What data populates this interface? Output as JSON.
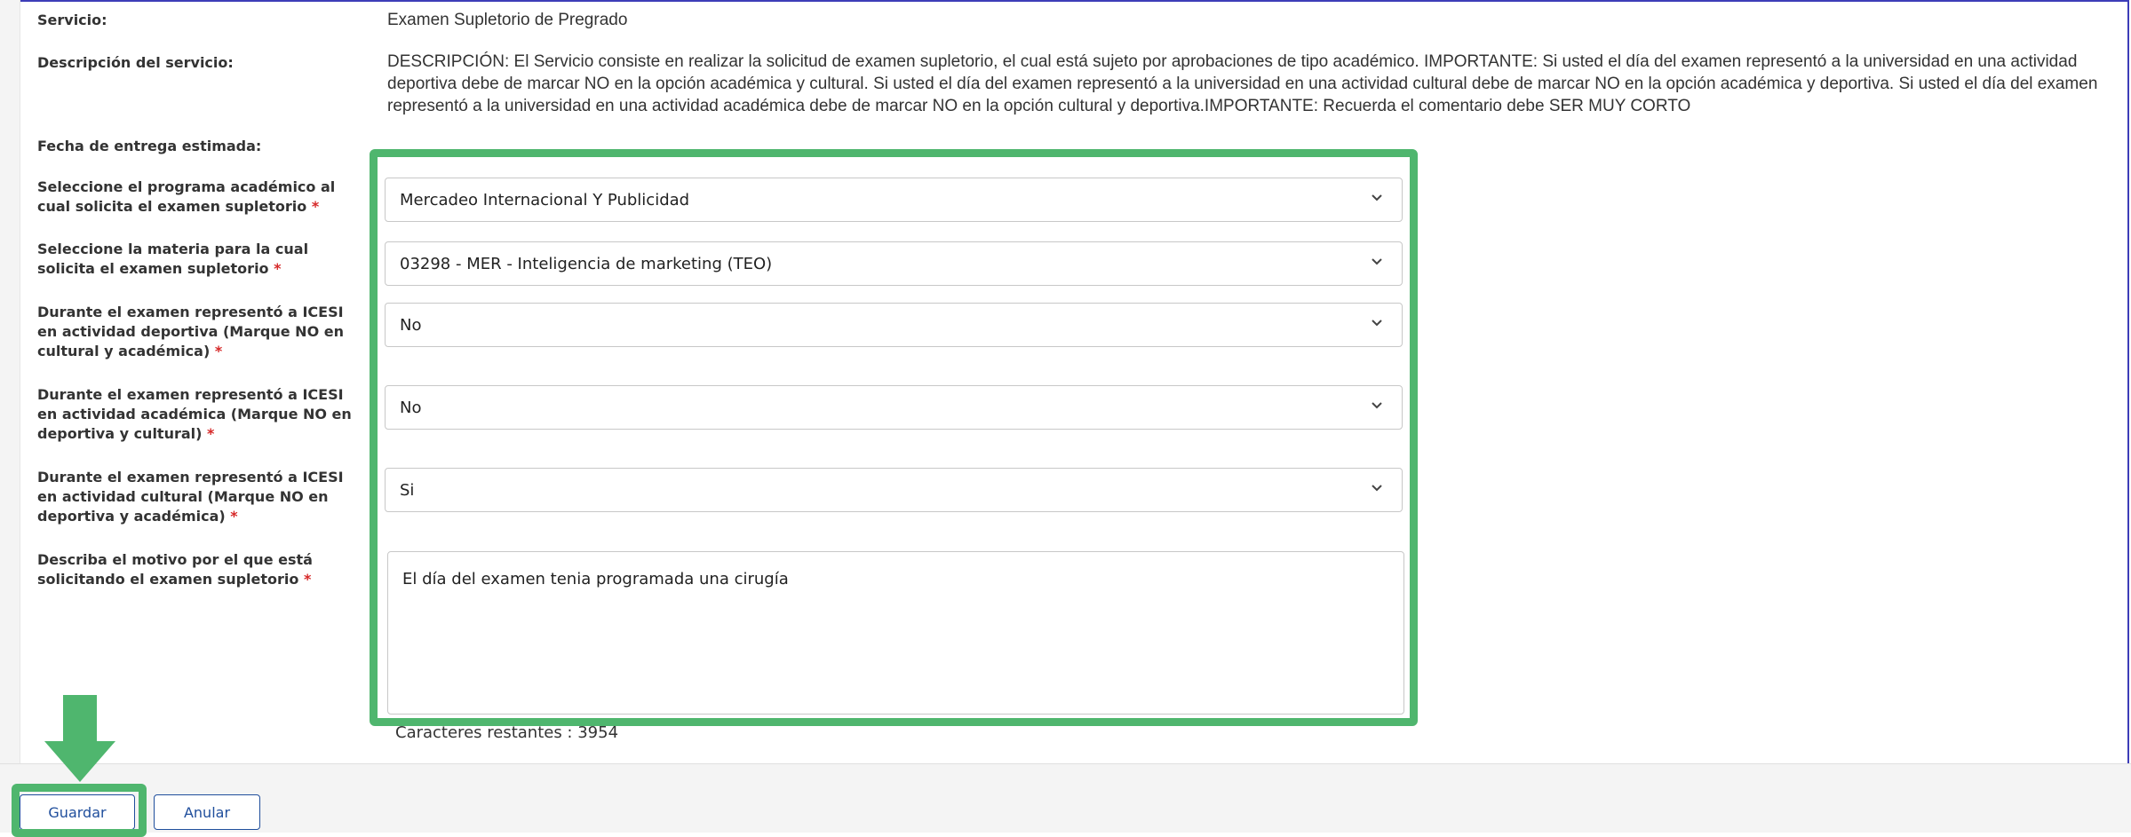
{
  "form": {
    "servicio_label": "Servicio:",
    "servicio_value": "Examen Supletorio de Pregrado",
    "descripcion_label": "Descripción del servicio:",
    "descripcion_value": "DESCRIPCIÓN: El Servicio consiste en realizar la solicitud de examen supletorio, el cual está sujeto por aprobaciones de tipo académico. IMPORTANTE: Si usted el día del examen representó a la universidad en una actividad deportiva debe de marcar NO en la opción académica y cultural. Si usted el día del examen representó a la universidad en una actividad cultural debe de marcar NO en la opción académica y deportiva. Si usted el día del examen representó a la universidad en una actividad académica debe de marcar NO en la opción cultural y deportiva.IMPORTANTE: Recuerda el comentario debe SER MUY CORTO",
    "fecha_label": "Fecha de entrega estimada:",
    "programa_label": "Seleccione el programa académico al cual solicita el examen supletorio",
    "programa_value": "Mercadeo Internacional Y Publicidad",
    "materia_label": "Seleccione la materia para la cual solicita el examen supletorio",
    "materia_value": "03298 - MER - Inteligencia de marketing (TEO)",
    "deportiva_label": "Durante el examen representó a ICESI en actividad deportiva (Marque NO en cultural y académica)",
    "deportiva_value": "No",
    "academica_label": "Durante el examen representó a ICESI en actividad académica (Marque NO en deportiva y cultural)",
    "academica_value": "No",
    "cultural_label": "Durante el examen representó a ICESI en actividad cultural (Marque NO en deportiva y académica)",
    "cultural_value": "Si",
    "motivo_label": "Describa el motivo por el que está solicitando el examen supletorio",
    "motivo_value": "El día del examen tenia programada una cirugía",
    "required_marker": "*",
    "counter_text": "Caracteres restantes : 3954"
  },
  "actions": {
    "guardar_label": "Guardar",
    "anular_label": "Anular"
  },
  "colors": {
    "highlight": "#4fb66e",
    "button_text": "#1f4e9c",
    "required": "#d62828"
  },
  "icons": {
    "dropdown": "chevron-down-icon",
    "annotation": "arrow-down-icon"
  }
}
